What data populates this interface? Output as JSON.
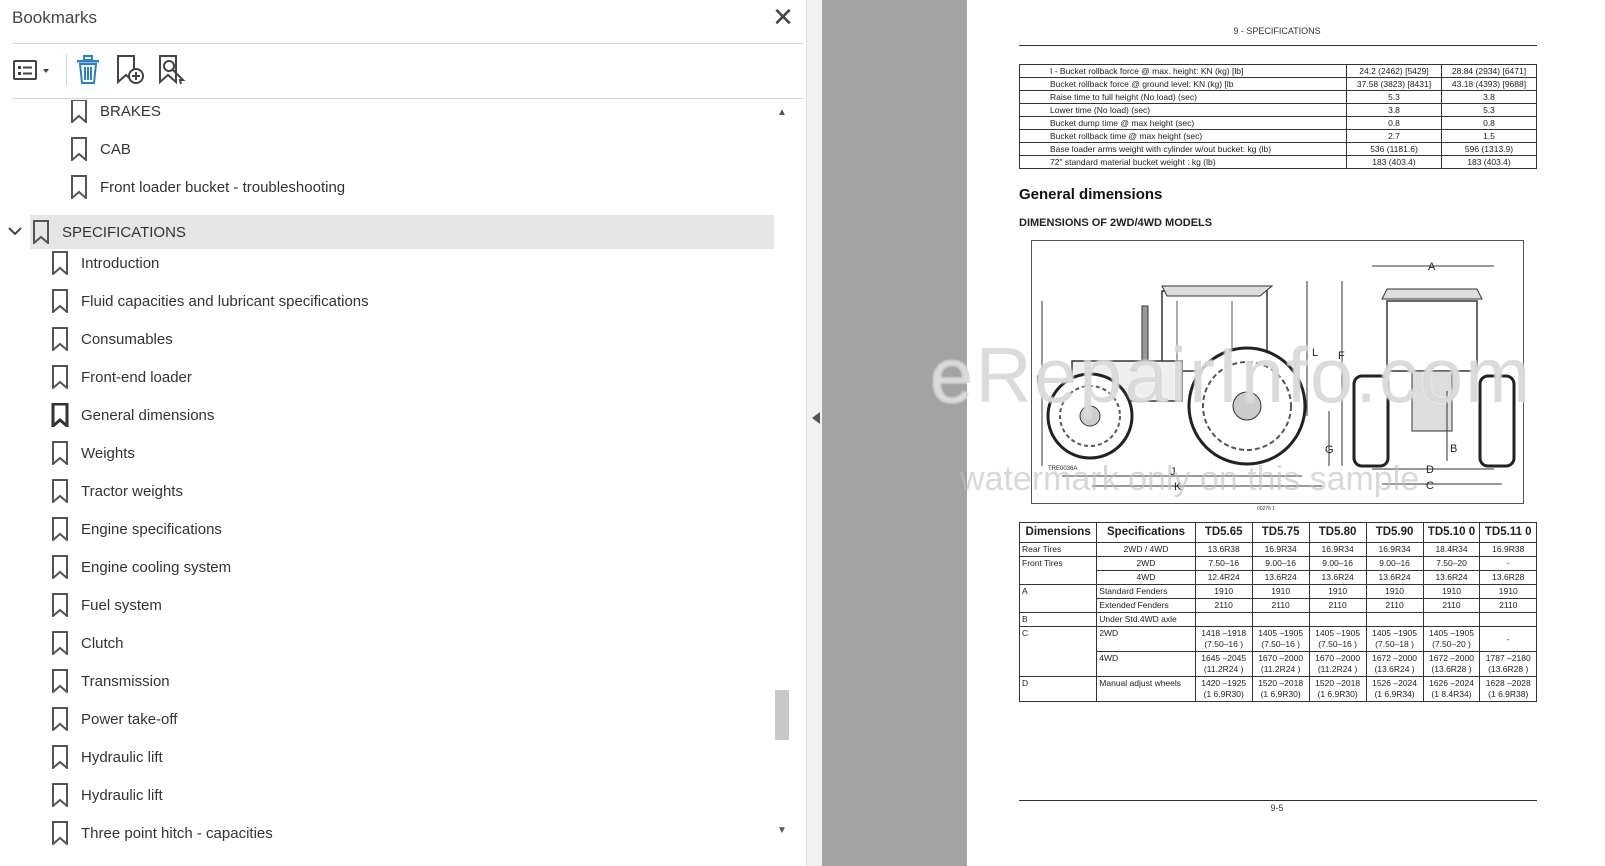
{
  "bookmarks_panel": {
    "title": "Bookmarks",
    "close_glyph": "✕",
    "toolbar": {
      "options_icon": "list-options-icon",
      "delete_icon": "trash-icon",
      "new_bookmark_icon": "add-bookmark-icon",
      "find_bookmark_icon": "find-current-bookmark-icon"
    },
    "items": [
      {
        "label": "BRAKES",
        "level": 2
      },
      {
        "label": "CAB",
        "level": 2
      },
      {
        "label": "Front loader bucket - troubleshooting",
        "level": 2
      },
      {
        "label": "SPECIFICATIONS",
        "level": 1,
        "expanded": true,
        "selected": true
      },
      {
        "label": "Introduction",
        "level": 2
      },
      {
        "label": "Fluid capacities and lubricant specifications",
        "level": 2
      },
      {
        "label": "Consumables",
        "level": 2
      },
      {
        "label": "Front-end loader",
        "level": 2
      },
      {
        "label": "General dimensions",
        "level": 2
      },
      {
        "label": "Weights",
        "level": 2
      },
      {
        "label": "Tractor weights",
        "level": 2
      },
      {
        "label": "Engine specifications",
        "level": 2
      },
      {
        "label": "Engine cooling system",
        "level": 2
      },
      {
        "label": "Fuel system",
        "level": 2
      },
      {
        "label": "Clutch",
        "level": 2
      },
      {
        "label": "Transmission",
        "level": 2
      },
      {
        "label": "Power take-off",
        "level": 2
      },
      {
        "label": "Hydraulic lift",
        "level": 2
      },
      {
        "label": "Hydraulic lift",
        "level": 2
      },
      {
        "label": "Three point hitch - capacities",
        "level": 2
      }
    ]
  },
  "document": {
    "header": "9 - SPECIFICATIONS",
    "loader_table": [
      [
        "I - Bucket rollback force @ max. height: KN (kg) [lb]",
        "24.2 (2462) [5429]",
        "28.84 (2934) [6471]"
      ],
      [
        "Bucket rollback force @ ground level: KN (kg) [lb",
        "37.58 (3823) [8431]",
        "43.18 (4393) [9688]"
      ],
      [
        "Raise time to full height (No load) (sec)",
        "5.3",
        "3.8"
      ],
      [
        "Lower time (No load) (sec)",
        "3.8",
        "5.3"
      ],
      [
        "Bucket dump time @ max height (sec)",
        "0.8",
        "0.8"
      ],
      [
        "Bucket rollback time @ max height (sec)",
        "2.7",
        "1.5"
      ],
      [
        "Base loader arms weight with cylinder w/out bucket: kg (lb)",
        "536 (1181.6)",
        "596 (1313.9)"
      ],
      [
        "72\" standard material bucket weight : kg (lb)",
        "183 (403.4)",
        "183 (403.4)"
      ]
    ],
    "section_title": "General dimensions",
    "section_subtitle": "DIMENSIONS OF 2WD/4WD MODELS",
    "figure_labels": {
      "A": "A",
      "B": "B",
      "C": "C",
      "D": "D",
      "E": "E",
      "F": "F",
      "G": "G",
      "J": "J",
      "K": "K",
      "L": "L"
    },
    "figure_ref": "TRE0036A",
    "figure_code": "00276    1",
    "dims_headers": [
      "Dimensions",
      "Specifications",
      "TD5.65",
      "TD5.75",
      "TD5.80",
      "TD5.90",
      "TD5.10 0",
      "TD5.11 0"
    ],
    "dims_rows": {
      "rear_tires": {
        "label": "Rear Tires",
        "spec": "2WD / 4WD",
        "values": [
          "13.6R38",
          "16.9R34",
          "16.9R34",
          "16.9R34",
          "18.4R34",
          "16.9R38"
        ]
      },
      "front_2wd": {
        "label": "Front Tires",
        "spec": "2WD",
        "values": [
          "7.50–16",
          "9.00–16",
          "9.00–16",
          "9.00–16",
          "7.50–20",
          "-"
        ]
      },
      "front_4wd": {
        "spec": "4WD",
        "values": [
          "12.4R24",
          "13.6R24",
          "13.6R24",
          "13.6R24",
          "13.6R24",
          "13.6R28"
        ]
      },
      "a_std": {
        "label": "A",
        "spec": "Standard Fenders",
        "values": [
          "1910",
          "1910",
          "1910",
          "1910",
          "1910",
          "1910"
        ]
      },
      "a_ext": {
        "spec": "Extended Fenders",
        "values": [
          "2110",
          "2110",
          "2110",
          "2110",
          "2110",
          "2110"
        ]
      },
      "b": {
        "label": "B",
        "spec": "Under Std.4WD axle"
      },
      "c_2wd": {
        "label": "C",
        "spec": "2WD",
        "values": [
          "1418 –1918 (7.50–16 )",
          "1405 –1905 (7.50–16 )",
          "1405 –1905 (7.50–16 )",
          "1405 –1905 (7.50–18 )",
          "1405 –1905 (7.50–20 )",
          "-"
        ]
      },
      "c_4wd": {
        "spec": "4WD",
        "values": [
          "1645 –2045 (11.2R24 )",
          "1670 –2000 (11.2R24 )",
          "1670 –2000 (11.2R24 )",
          "1672 –2000 (13.6R24 )",
          "1672 –2000 (13.6R28 )",
          "1787 –2180 (13.6R28 )"
        ]
      },
      "d": {
        "label": "D",
        "spec": "Manual adjust wheels",
        "values": [
          "1420 –1925 (1 6.9R30)",
          "1520 –2018 (1 6.9R30)",
          "1520 –2018 (1 6.9R30)",
          "1526 –2024 (1 6.9R34)",
          "1626 –2024 (1 8.4R34)",
          "1628 –2028 (1 6.9R38)"
        ]
      }
    },
    "page_number": "9-5"
  },
  "watermark": {
    "line1": "eRepairInfo.com",
    "line2": "watermark only on this sample"
  }
}
